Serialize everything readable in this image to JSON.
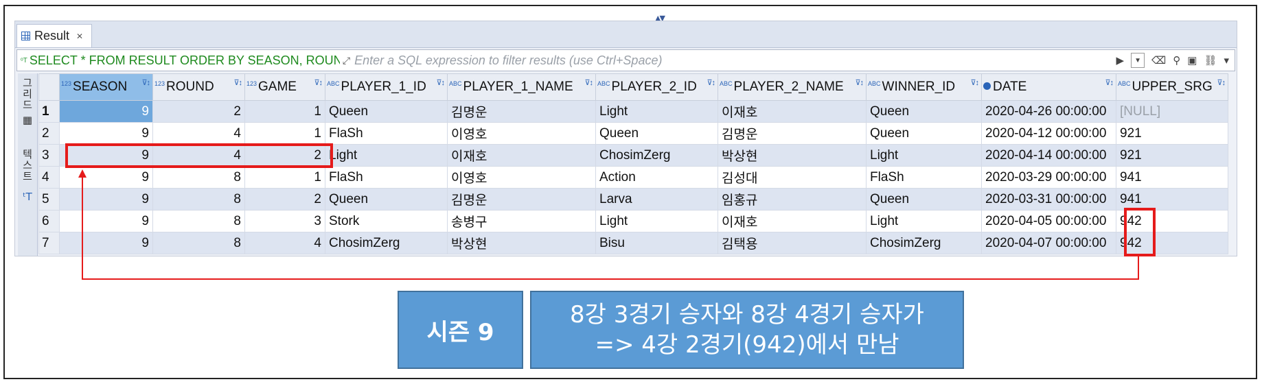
{
  "window": {
    "tab_label": "Result",
    "tab_close": "✕"
  },
  "filter_bar": {
    "sql_icon": "sql-icon",
    "sql_text": "SELECT * FROM RESULT ORDER BY SEASON, ROUND, GAME",
    "filter_placeholder": "Enter a SQL expression to filter results (use Ctrl+Space)"
  },
  "sidebar": {
    "grid_tab": "그리드",
    "text_tab": "텍스트"
  },
  "columns": [
    {
      "name": "SEASON",
      "type_badge": "123",
      "type": "number"
    },
    {
      "name": "ROUND",
      "type_badge": "123",
      "type": "number"
    },
    {
      "name": "GAME",
      "type_badge": "123",
      "type": "number"
    },
    {
      "name": "PLAYER_1_ID",
      "type_badge": "ABC",
      "type": "text"
    },
    {
      "name": "PLAYER_1_NAME",
      "type_badge": "ABC",
      "type": "text"
    },
    {
      "name": "PLAYER_2_ID",
      "type_badge": "ABC",
      "type": "text"
    },
    {
      "name": "PLAYER_2_NAME",
      "type_badge": "ABC",
      "type": "text"
    },
    {
      "name": "WINNER_ID",
      "type_badge": "ABC",
      "type": "text"
    },
    {
      "name": "DATE",
      "type_badge": "clock-icon",
      "type": "date"
    },
    {
      "name": "UPPER_SRG",
      "type_badge": "ABC",
      "type": "text"
    }
  ],
  "rows": [
    {
      "num": "1",
      "cells": [
        "9",
        "2",
        "1",
        "Queen",
        "김명운",
        "Light",
        "이재호",
        "Queen",
        "2020-04-26 00:00:00",
        "[NULL]"
      ]
    },
    {
      "num": "2",
      "cells": [
        "9",
        "4",
        "1",
        "FlaSh",
        "이영호",
        "Queen",
        "김명운",
        "Queen",
        "2020-04-12 00:00:00",
        "921"
      ]
    },
    {
      "num": "3",
      "cells": [
        "9",
        "4",
        "2",
        "Light",
        "이재호",
        "ChosimZerg",
        "박상현",
        "Light",
        "2020-04-14 00:00:00",
        "921"
      ]
    },
    {
      "num": "4",
      "cells": [
        "9",
        "8",
        "1",
        "FlaSh",
        "이영호",
        "Action",
        "김성대",
        "FlaSh",
        "2020-03-29 00:00:00",
        "941"
      ]
    },
    {
      "num": "5",
      "cells": [
        "9",
        "8",
        "2",
        "Queen",
        "김명운",
        "Larva",
        "임홍규",
        "Queen",
        "2020-03-31 00:00:00",
        "941"
      ]
    },
    {
      "num": "6",
      "cells": [
        "9",
        "8",
        "3",
        "Stork",
        "송병구",
        "Light",
        "이재호",
        "Light",
        "2020-04-05 00:00:00",
        "942"
      ]
    },
    {
      "num": "7",
      "cells": [
        "9",
        "8",
        "4",
        "ChosimZerg",
        "박상현",
        "Bisu",
        "김택용",
        "ChosimZerg",
        "2020-04-07 00:00:00",
        "942"
      ]
    }
  ],
  "annotation": {
    "season_label": "시즌 9",
    "desc_line1": "8강 3경기 승자와 8강 4경기 승자가",
    "desc_line2": "=> 4강 2경기(942)에서 만남",
    "highlight_color": "#e51b1b",
    "callout_color": "#5b9bd5"
  }
}
